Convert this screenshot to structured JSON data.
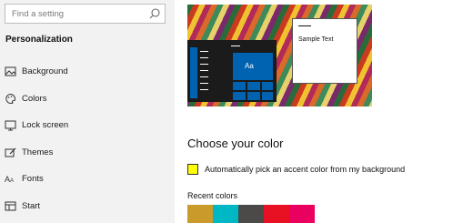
{
  "search": {
    "placeholder": "Find a setting",
    "icon": "search-icon"
  },
  "sidebar": {
    "section_title": "Personalization",
    "items": [
      {
        "label": "Background",
        "icon": "picture-icon"
      },
      {
        "label": "Colors",
        "icon": "palette-icon"
      },
      {
        "label": "Lock screen",
        "icon": "monitor-icon"
      },
      {
        "label": "Themes",
        "icon": "brush-icon"
      },
      {
        "label": "Fonts",
        "icon": "font-icon"
      },
      {
        "label": "Start",
        "icon": "start-icon"
      }
    ]
  },
  "preview": {
    "tile_text": "Aa",
    "window_text": "Sample Text",
    "accent": "#0063b1"
  },
  "main": {
    "heading": "Choose your color",
    "auto_accent": {
      "label": "Automatically pick an accent color from my background",
      "checkbox_color": "#ffff00"
    },
    "recent_colors_label": "Recent colors",
    "recent_colors": [
      "#ca9a2a",
      "#00b8c4",
      "#4c4a48",
      "#e81123",
      "#ea005e"
    ]
  }
}
